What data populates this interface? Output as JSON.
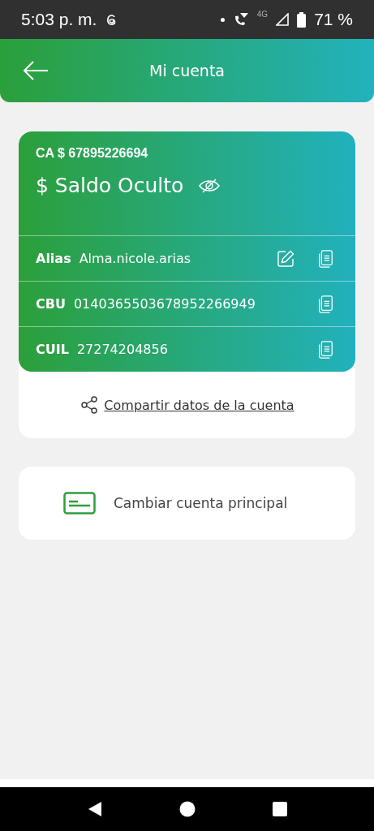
{
  "status_bar": {
    "time": "5:03 p. m.",
    "network": "4G",
    "battery": "71 %"
  },
  "header": {
    "title": "Mi cuenta"
  },
  "account": {
    "number": "CA $ 67895226694",
    "balance": "$ Saldo Oculto",
    "balance_hidden": true,
    "rows": [
      {
        "label": "Alias",
        "value": "Alma.nicole.arias",
        "editable": true
      },
      {
        "label": "CBU",
        "value": "0140365503678952266949",
        "editable": false
      },
      {
        "label": "CUIL",
        "value": "27274204856",
        "editable": false
      }
    ],
    "share_link": "Compartir datos de la cuenta"
  },
  "actions": [
    {
      "label": "Cambiar cuenta principal"
    }
  ]
}
